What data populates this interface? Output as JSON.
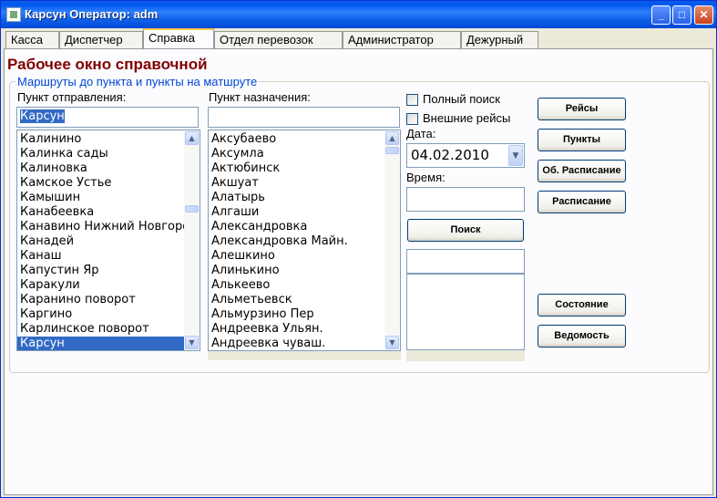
{
  "window": {
    "title": "Карсун  Оператор: adm"
  },
  "tabs": [
    {
      "label": "Касса"
    },
    {
      "label": "Диспетчер"
    },
    {
      "label": "Справка"
    },
    {
      "label": "Отдел перевозок"
    },
    {
      "label": "Администратор"
    },
    {
      "label": "Дежурный"
    }
  ],
  "page": {
    "title": "Рабочее окно справочной"
  },
  "group": {
    "legend": "Маршруты до пункта и пункты на матшруте"
  },
  "departure": {
    "label": "Пункт отправления:",
    "input_value": "Карсун",
    "items": [
      "Калинино",
      "Калинка сады",
      "Калиновка",
      "Камское Устье",
      "Камышин",
      "Канабеевка",
      "Канавино Нижний Новгород",
      "Канадей",
      "Канаш",
      "Капустин Яр",
      "Каракули",
      "Каранино поворот",
      "Каргино",
      "Карлинское поворот",
      "Карсун"
    ],
    "selected": "Карсун"
  },
  "destination": {
    "label": "Пункт назначения:",
    "input_value": "",
    "items": [
      "Аксубаево",
      "Аксумла",
      "Актюбинск",
      "Акшуат",
      "Алатырь",
      "Алгаши",
      "Александровка",
      "Александровка Майн.",
      "Алешкино",
      "Алинькино",
      "Алькеево",
      "Альметьевск",
      "Альмурзино Пер",
      "Андреевка Ульян.",
      "Андреевка чуваш."
    ]
  },
  "options": {
    "full_search": "Полный поиск",
    "external_routes": "Внешние рейсы"
  },
  "date": {
    "label": "Дата:",
    "value": "04.02.2010"
  },
  "time": {
    "label": "Время:",
    "value": ""
  },
  "buttons": {
    "search": "Поиск",
    "routes": "Рейсы",
    "points": "Пункты",
    "general_schedule": "Об. Расписание",
    "schedule": "Расписание",
    "status": "Состояние",
    "statement": "Ведомость"
  },
  "colors": {
    "accent": "#800000",
    "legend": "#0046d5",
    "selection": "#316ac5"
  }
}
